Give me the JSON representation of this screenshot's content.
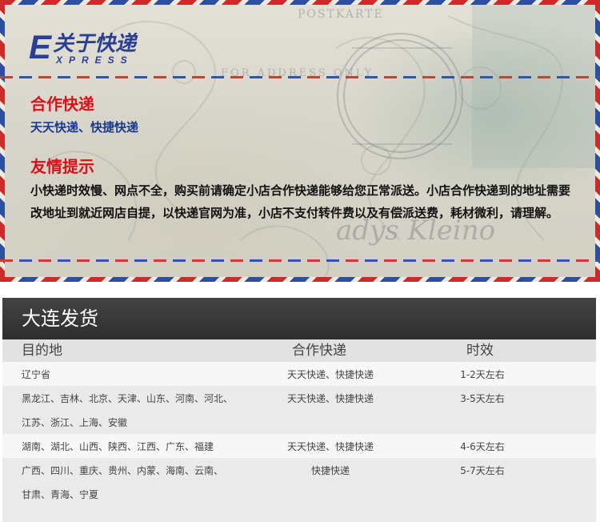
{
  "logo": {
    "letter": "E",
    "title": "关于快递",
    "subtitle": "XPRESS"
  },
  "partners": {
    "heading": "合作快递",
    "text": "天天快递、快捷快递"
  },
  "notice": {
    "heading": "友情提示",
    "text": "小快递时效慢、网点不全，购买前请确定小店合作快递能够给您正常派送。小店合作快递到的地址需要改地址到就近网店自提，以快递官网为准，小店不支付转件费以及有偿派送费，耗材微利，请理解。"
  },
  "shipping": {
    "title": "大连发货",
    "columns": {
      "destination": "目的地",
      "courier": "合作快递",
      "time": "时效"
    },
    "rows": [
      {
        "destination_lines": [
          "辽宁省"
        ],
        "courier": "天天快递、快捷快递",
        "time": "1-2天左右"
      },
      {
        "destination_lines": [
          "黑龙江、吉林、北京、天津、山东、河南、河北、",
          "江苏、浙江、上海、安徽"
        ],
        "courier": "天天快递、快捷快递",
        "time": "3-5天左右"
      },
      {
        "destination_lines": [
          "湖南、湖北、山西、陕西、江西、广东、福建"
        ],
        "courier": "天天快递、快捷快递",
        "time": "4-6天左右"
      },
      {
        "destination_lines": [
          "广西、四川、重庆、贵州、内蒙、海南、云南、",
          "甘肃、青海、宁夏"
        ],
        "courier": "快捷快递",
        "time": "5-7天左右"
      }
    ]
  },
  "colors": {
    "heading_red": "#d8101a",
    "text_blue": "#1a3a8e",
    "logo_blue": "#2a3f94",
    "header_dark": "#333333"
  }
}
